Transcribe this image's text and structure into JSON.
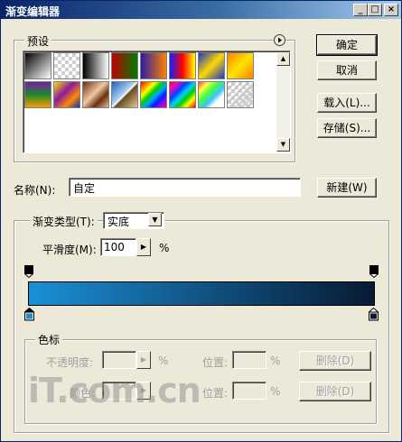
{
  "window": {
    "title": "渐变编辑器"
  },
  "titlebar_buttons": {
    "minimize": "_",
    "maximize": "□",
    "close": "×"
  },
  "presets": {
    "label": "预设",
    "menu_icon": "arrow-circle-icon",
    "swatches": [
      {
        "name": "foreground-to-background",
        "css": "linear-gradient(135deg,#000 0%,#fff 100%)"
      },
      {
        "name": "foreground-to-transparent",
        "css": "checker"
      },
      {
        "name": "black-white",
        "css": "linear-gradient(90deg,#000 0%,#fff 100%)"
      },
      {
        "name": "red-green",
        "css": "linear-gradient(90deg,#c00000 0%,#007a00 100%)"
      },
      {
        "name": "violet-orange",
        "css": "linear-gradient(90deg,#2b1aa8 0%,#ff8000 100%)"
      },
      {
        "name": "blue-red-yellow",
        "css": "linear-gradient(90deg,#1020ff 0%,#ff0000 50%,#ffff00 100%)"
      },
      {
        "name": "blue-yellow-blue",
        "css": "linear-gradient(135deg,#1838c0 0%,#ffd800 50%,#1838c0 100%)"
      },
      {
        "name": "orange-yellow-orange",
        "css": "linear-gradient(135deg,#ff8000 0%,#ffe400 50%,#ff8000 100%)"
      },
      {
        "name": "violet-green-orange",
        "css": "linear-gradient(180deg,#7a1aa8 0%,#198a2a 50%,#ff9a00 100%)"
      },
      {
        "name": "yellow-violet-orange-blue",
        "css": "linear-gradient(135deg,#ffe000 0%,#8a1aa0 40%,#ff8a00 70%,#1030c0 100%)"
      },
      {
        "name": "copper",
        "css": "linear-gradient(135deg,#6a3010 0%,#f0c8a0 45%,#6a3010 70%,#e8b890 100%)"
      },
      {
        "name": "chrome",
        "css": "linear-gradient(135deg,#2060c0 0%,#a8d0f0 45%,#ffffff 50%,#6a4a20 55%,#e0c8a0 100%)"
      },
      {
        "name": "spectrum",
        "css": "linear-gradient(135deg,#ff0000,#ff8000,#ffff00,#00d000,#00a0ff,#0020ff,#a000ff,#ff0060)"
      },
      {
        "name": "transparent-rainbow",
        "css": "linear-gradient(135deg,#ff0000 0%,#ff00c0 15%,#0040ff 35%,#00d0ff 50%,#00d000 65%,#ffff00 80%,#ff0000 100%)"
      },
      {
        "name": "transparent-stripes",
        "css": "linear-gradient(135deg,#ff4040 0%,#ffff40 20%,#40ff40 40%,#40c0ff 60%,#ffffff 75%,#ffffff 100%)"
      },
      {
        "name": "neutral-density",
        "css": "checker-stripes"
      }
    ]
  },
  "buttons": {
    "ok": "确定",
    "cancel": "取消",
    "load": "载入(L)...",
    "save": "存储(S)...",
    "new": "新建(W)"
  },
  "name_field": {
    "label": "名称(N):",
    "value": "自定"
  },
  "gradient_type": {
    "label": "渐变类型(T):",
    "selected": "实底",
    "options": [
      "实底"
    ]
  },
  "smoothness": {
    "label": "平滑度(M):",
    "value": "100",
    "unit": "%"
  },
  "gradient": {
    "start_color": "#1a8fd6",
    "end_color": "#071a33"
  },
  "color_stops": {
    "label": "色标",
    "opacity_label": "不透明度:",
    "opacity_unit": "%",
    "opacity_location_label": "位置:",
    "opacity_location_unit": "%",
    "opacity_delete": "删除(D)",
    "color_label": "颜色:",
    "color_location_label": "位置:",
    "color_location_unit": "%",
    "color_delete": "删除(D)"
  },
  "watermark": "iT.com.cn"
}
